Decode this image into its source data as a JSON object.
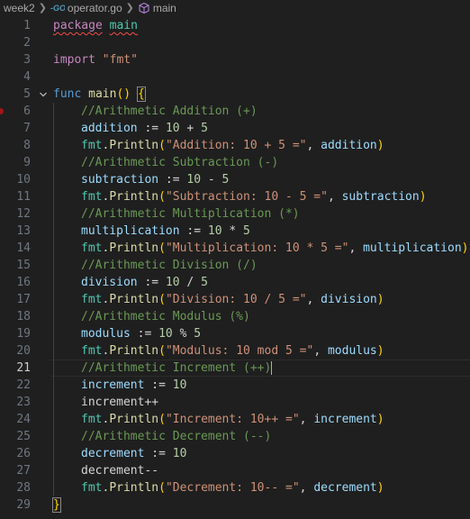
{
  "breadcrumb": {
    "folder": "week2",
    "file": "operator.go",
    "symbol": "main"
  },
  "editor": {
    "active_line": 21,
    "lines": [
      {
        "n": "1"
      },
      {
        "n": "2"
      },
      {
        "n": "3"
      },
      {
        "n": "4"
      },
      {
        "n": "5"
      },
      {
        "n": "6"
      },
      {
        "n": "7"
      },
      {
        "n": "8"
      },
      {
        "n": "9"
      },
      {
        "n": "10"
      },
      {
        "n": "11"
      },
      {
        "n": "12"
      },
      {
        "n": "13"
      },
      {
        "n": "14"
      },
      {
        "n": "15"
      },
      {
        "n": "16"
      },
      {
        "n": "17"
      },
      {
        "n": "18"
      },
      {
        "n": "19"
      },
      {
        "n": "20"
      },
      {
        "n": "21"
      },
      {
        "n": "22"
      },
      {
        "n": "23"
      },
      {
        "n": "24"
      },
      {
        "n": "25"
      },
      {
        "n": "26"
      },
      {
        "n": "27"
      },
      {
        "n": "28"
      },
      {
        "n": "29"
      }
    ],
    "tokens": {
      "l1": [
        "package",
        "main"
      ],
      "l3": [
        "import",
        "\"fmt\""
      ],
      "l5": [
        "func",
        "main",
        "()",
        "{"
      ],
      "l6": "//Arithmetic Addition (+)",
      "l7": [
        "addition",
        ":=",
        "10",
        "+",
        "5"
      ],
      "l8": [
        "fmt",
        ".",
        "Println",
        "(",
        "\"Addition: 10 + 5 =\"",
        ", ",
        "addition",
        ")"
      ],
      "l9": "//Arithmetic Subtraction (-)",
      "l10": [
        "subtraction",
        ":=",
        "10",
        "-",
        "5"
      ],
      "l11": [
        "fmt",
        ".",
        "Println",
        "(",
        "\"Subtraction: 10 - 5 =\"",
        ", ",
        "subtraction",
        ")"
      ],
      "l12": "//Arithmetic Multiplication (*)",
      "l13": [
        "multiplication",
        ":=",
        "10",
        "*",
        "5"
      ],
      "l14": [
        "fmt",
        ".",
        "Println",
        "(",
        "\"Multiplication: 10 * 5 =\"",
        ", ",
        "multiplication",
        ")"
      ],
      "l15": "//Arithmetic Division (/)",
      "l16": [
        "division",
        ":=",
        "10",
        "/",
        "5"
      ],
      "l17": [
        "fmt",
        ".",
        "Println",
        "(",
        "\"Division: 10 / 5 =\"",
        ", ",
        "division",
        ")"
      ],
      "l18": "//Arithmetic Modulus (%)",
      "l19": [
        "modulus",
        ":=",
        "10",
        "%",
        "5"
      ],
      "l20": [
        "fmt",
        ".",
        "Println",
        "(",
        "\"Modulus: 10 mod 5 =\"",
        ", ",
        "modulus",
        ")"
      ],
      "l21": "//Arithmetic Increment (++)",
      "l22": [
        "increment",
        ":=",
        "10"
      ],
      "l23": [
        "increment",
        "++"
      ],
      "l24": [
        "fmt",
        ".",
        "Println",
        "(",
        "\"Increment: 10++ =\"",
        ", ",
        "increment",
        ")"
      ],
      "l25": "//Arithmetic Decrement (--)",
      "l26": [
        "decrement",
        ":=",
        "10"
      ],
      "l27": [
        "decrement",
        "--"
      ],
      "l28": [
        "fmt",
        ".",
        "Println",
        "(",
        "\"Decrement: 10-- =\"",
        ", ",
        "decrement",
        ")"
      ],
      "l29": "}"
    }
  },
  "colors": {
    "background": "#1f1f1f",
    "keyword": "#569cd6",
    "string": "#ce9178",
    "comment": "#6a9955",
    "variable": "#9cdcfe",
    "package": "#4ec9b0",
    "function": "#dcdcaa",
    "number": "#b5cea8",
    "bracket": "#ffd700",
    "breakpoint": "#a31515"
  }
}
